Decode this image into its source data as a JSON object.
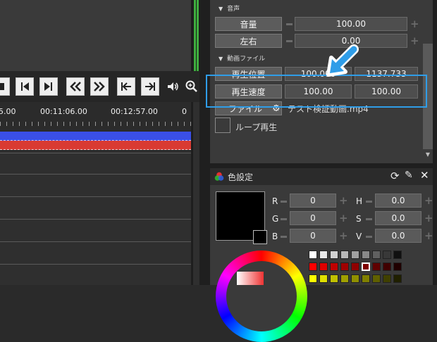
{
  "timeline": {
    "timecodes": [
      "5.00",
      "00:11:06.00",
      "00:12:57.00",
      "0"
    ],
    "controls": [
      "stop-icon",
      "step-back-icon",
      "step-forward-icon",
      "rewind-icon",
      "fast-forward-icon",
      "go-start-icon",
      "go-end-icon",
      "volume-icon",
      "zoom-icon"
    ]
  },
  "properties": {
    "audio_section": "音声",
    "volume_label": "音量",
    "volume_value": "100.00",
    "pan_label": "左右",
    "pan_value": "0.00",
    "video_section": "動画ファイル",
    "position_label": "再生位置",
    "position_start": "100.000",
    "position_end": "1137.733",
    "speed_label": "再生速度",
    "speed_value1": "100.00",
    "speed_value2": "100.00",
    "file_label": "ファイル",
    "file_name": "テスト検証動画.mp4",
    "loop_label": "ループ再生"
  },
  "color_panel": {
    "title": "色設定",
    "r_label": "R",
    "r_value": "0",
    "g_label": "G",
    "g_value": "0",
    "b_label": "B",
    "b_value": "0",
    "h_label": "H",
    "h_value": "0.0",
    "s_label": "S",
    "s_value": "0.0",
    "v_label": "V",
    "v_value": "0.0",
    "palette_rows": [
      [
        "#ffffff",
        "#e8e8e8",
        "#d0d0d0",
        "#b8b8b8",
        "#a0a0a0",
        "#888888",
        "#606060",
        "#383838",
        "#101010"
      ],
      [
        "#ff0000",
        "#e00000",
        "#c00000",
        "#a00000",
        "#900000",
        "#800000",
        "#600000",
        "#400000",
        "#200000"
      ],
      [
        "#ffff00",
        "#e0e000",
        "#c0c000",
        "#a0a000",
        "#909000",
        "#808000",
        "#606000",
        "#404000",
        "#202000"
      ]
    ]
  },
  "colors": {
    "accent": "#2f9de8",
    "meter": "#3fae3f"
  }
}
